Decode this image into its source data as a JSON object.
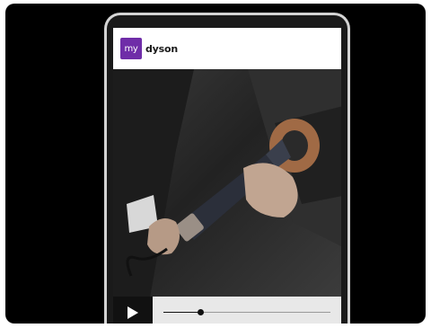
{
  "app": {
    "logo_badge_text": "my",
    "logo_word": "dyson",
    "brand_color": "#6f2da8"
  },
  "player": {
    "play_icon": "play-icon",
    "progress_fraction": 0.22
  }
}
